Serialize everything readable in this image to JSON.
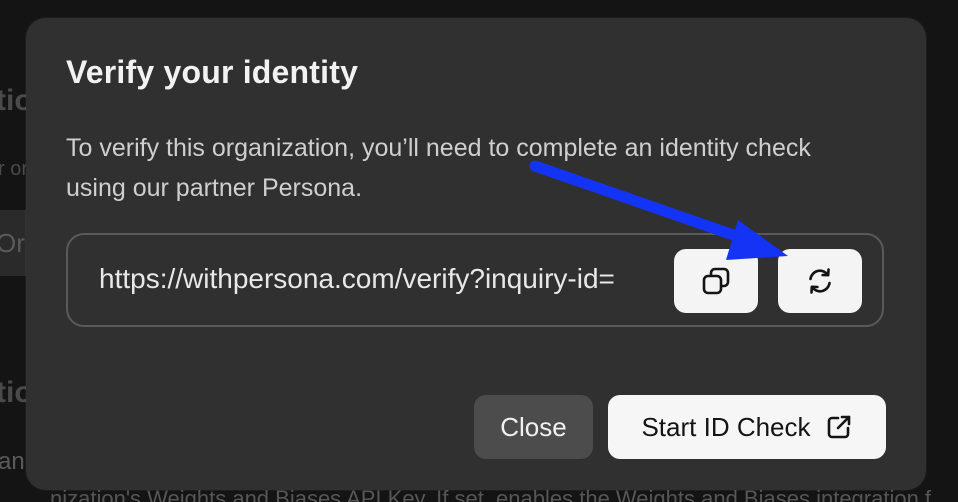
{
  "background": {
    "fragment_heading_1": "tio",
    "fragment_sub_1": "r or",
    "fragment_org": "Org",
    "fragment_heading_2": "tio",
    "fragment_line": "an",
    "fragment_footer": "nization's Weights and Biases API Key. If set, enables the Weights and Biases integration f"
  },
  "dialog": {
    "title": "Verify your identity",
    "description": "To verify this organization, you’ll need to complete an identity check using our partner Persona.",
    "url": "https://withpersona.com/verify?inquiry-id=",
    "copy_icon": "copy-icon",
    "refresh_icon": "refresh-icon",
    "close_label": "Close",
    "start_label": "Start ID Check",
    "start_icon": "external-link-icon"
  },
  "annotation": {
    "arrow_color": "#1434f5"
  }
}
